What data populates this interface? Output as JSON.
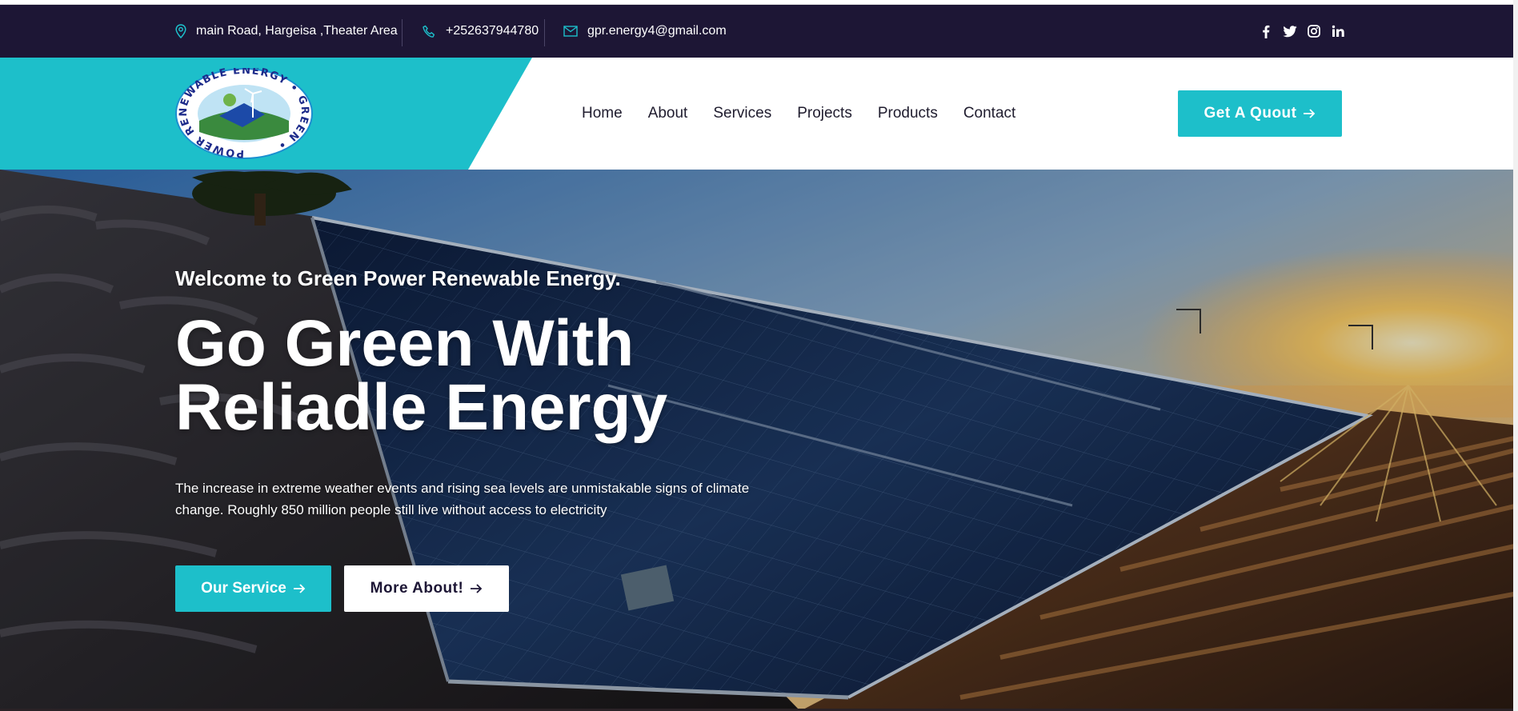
{
  "topbar": {
    "address": "main Road, Hargeisa ,Theater Area",
    "phone": "+252637944780",
    "email": "gpr.energy4@gmail.com",
    "social_icons": [
      "facebook-icon",
      "twitter-icon",
      "instagram-icon",
      "linkedin-icon"
    ]
  },
  "logo": {
    "ring_text": "POWER RENEWABLE ENERGY • GREEN •",
    "alt": "Green Power Renewable Energy logo"
  },
  "nav": {
    "items": [
      {
        "label": "Home"
      },
      {
        "label": "About"
      },
      {
        "label": "Services"
      },
      {
        "label": "Projects"
      },
      {
        "label": "Products"
      },
      {
        "label": "Contact"
      }
    ]
  },
  "header": {
    "cta_label": "Get A Quout"
  },
  "hero": {
    "welcome": "Welcome to Green Power Renewable Energy.",
    "headline_line1": "Go Green With",
    "headline_line2": "Reliadle Energy",
    "description": "The increase in extreme weather events and rising sea levels are unmistakable signs of climate change. Roughly 850 million people still live without access to electricity",
    "primary_button": "Our Service",
    "secondary_button": "More About!"
  },
  "colors": {
    "accent": "#1dbfca",
    "topbar_bg": "#1d1635",
    "text_dark": "#1f1c2e"
  }
}
